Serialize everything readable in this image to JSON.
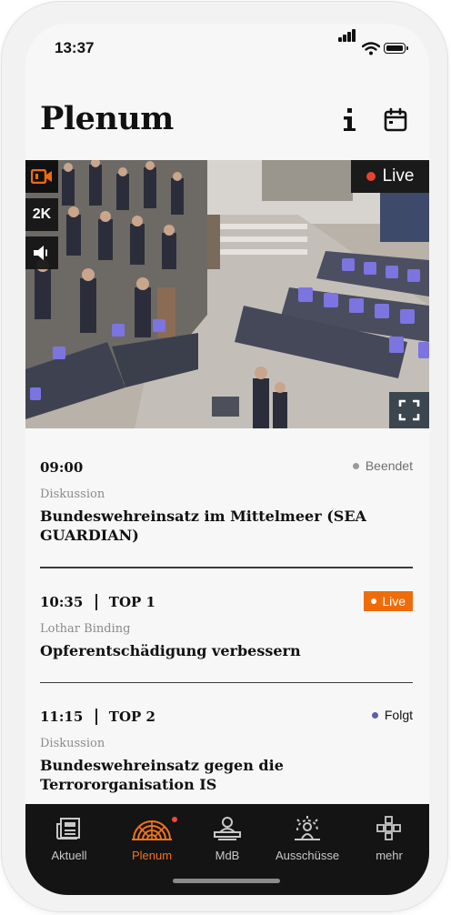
{
  "status_bar": {
    "time": "13:37"
  },
  "header": {
    "title": "Plenum",
    "info_icon": "info-icon",
    "calendar_icon": "calendar-icon"
  },
  "video": {
    "live_label": "Live",
    "resolution_label": "2K",
    "camera_icon": "camera-icon",
    "mute_icon": "speaker-mute-icon",
    "fullscreen_icon": "fullscreen-icon",
    "colors": {
      "camera_accent": "#ef6c0a",
      "live_dot": "#e8432f"
    }
  },
  "agenda": [
    {
      "time": "09:00",
      "top": "",
      "status": "Beendet",
      "status_color": "#9a9a9a",
      "subtitle": "Diskussion",
      "title": "Bundeswehreinsatz im Mittelmeer (SEA GUARDIAN)"
    },
    {
      "time": "10:35",
      "top": "TOP 1",
      "status": "Live",
      "status_color": "#ef6c0a",
      "subtitle": "Lothar Binding",
      "title": "Opferentschädigung verbessern"
    },
    {
      "time": "11:15",
      "top": "TOP 2",
      "status": "Folgt",
      "status_color": "#5b5fa8",
      "subtitle": "Diskussion",
      "title": "Bundeswehreinsatz gegen die Terrororganisation IS"
    }
  ],
  "tabbar": {
    "items": [
      {
        "label": "Aktuell",
        "icon": "newspaper-icon",
        "active": false
      },
      {
        "label": "Plenum",
        "icon": "plenum-seats-icon",
        "active": true,
        "badge": true
      },
      {
        "label": "MdB",
        "icon": "member-podium-icon",
        "active": false
      },
      {
        "label": "Ausschüsse",
        "icon": "committee-icon",
        "active": false
      },
      {
        "label": "mehr",
        "icon": "more-grid-icon",
        "active": false
      }
    ],
    "colors": {
      "active": "#f0731c",
      "inactive": "#c9c9c9",
      "background": "#141414"
    }
  }
}
